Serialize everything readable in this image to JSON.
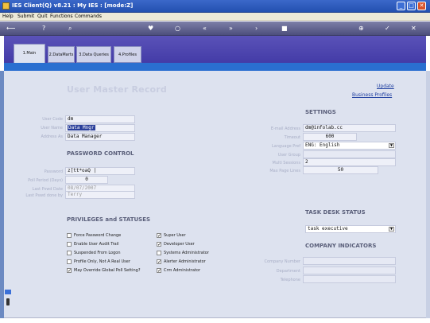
{
  "window": {
    "title": "IES Client(Q) v8.21 : My IES :      [mode:Z]"
  },
  "menu": {
    "items": [
      "Help",
      "Submit",
      "Quit",
      "Functions",
      "Commands"
    ]
  },
  "toolbar": {
    "icons": [
      "back-arrow-icon",
      "help-icon",
      "search-icon",
      "heart-icon",
      "hint-icon",
      "rewind-icon",
      "forward-icon",
      "next-icon",
      "stop-icon",
      "add-icon",
      "confirm-icon",
      "cancel-icon"
    ]
  },
  "tabs": [
    {
      "label": "1.Main",
      "active": true
    },
    {
      "label": "2.DataMarts",
      "active": false
    },
    {
      "label": "3.Data Queries",
      "active": false
    },
    {
      "label": "4.Profiles",
      "active": false
    }
  ],
  "page": {
    "title": "User Master Record",
    "update_link": "Update",
    "business_profiles_link": "Business Profiles"
  },
  "user": {
    "labels": {
      "code": "User Code",
      "name": "User Name",
      "address_as": "Address As"
    },
    "code": "dm",
    "name": "Data Mngr",
    "address_as": "Data Manager"
  },
  "password": {
    "section_title": "PASSWORD CONTROL",
    "labels": {
      "password": "Password",
      "poll_period": "Poll Period (Days)",
      "last_pswd_date": "Last Pswd Date",
      "last_pswd_done_by": "Last Pswd done by"
    },
    "password": "z[tt*oaQ |",
    "poll_period": "0",
    "last_pswd_date": "08/07/2007",
    "last_pswd_done_by": "Terry"
  },
  "privileges": {
    "section_title": "PRIVILEGES and STATUSES",
    "left": [
      {
        "label": "Force Password Change",
        "checked": false
      },
      {
        "label": "Enable User Audit Trail",
        "checked": false
      },
      {
        "label": "Suspended From Logon",
        "checked": false
      },
      {
        "label": "Profile Only, Not A Real User",
        "checked": false
      },
      {
        "label": "May Override Global Poll Setting?",
        "checked": true
      }
    ],
    "right": [
      {
        "label": "Super User",
        "checked": true
      },
      {
        "label": "Developer User",
        "checked": true
      },
      {
        "label": "Systems Administrator",
        "checked": false
      },
      {
        "label": "Alerter Administrator",
        "checked": true
      },
      {
        "label": "Crm Administrator",
        "checked": true
      }
    ]
  },
  "settings": {
    "section_title": "SETTINGS",
    "labels": {
      "email": "E-mail Address",
      "timeout": "Timeout",
      "language": "Language Pref",
      "user_group": "User Group",
      "multi_sessions": "Multi Sessions",
      "max_page_lines": "Max Page Lines"
    },
    "email": "dm@infolab.cc",
    "timeout": "600",
    "language": "ENG: English",
    "user_group": "",
    "multi_sessions": "2",
    "max_page_lines": "50"
  },
  "task_desk": {
    "section_title": "TASK DESK STATUS",
    "value": "task executive"
  },
  "company": {
    "section_title": "COMPANY INDICATORS",
    "labels": {
      "number": "Company Number",
      "department": "Department",
      "telephone": "Telephone"
    },
    "number": "",
    "department": "",
    "telephone": ""
  },
  "colors": {
    "accent": "#3d35a2",
    "tab_strip": "#2a6fd0",
    "panel": "#dde2ef"
  }
}
